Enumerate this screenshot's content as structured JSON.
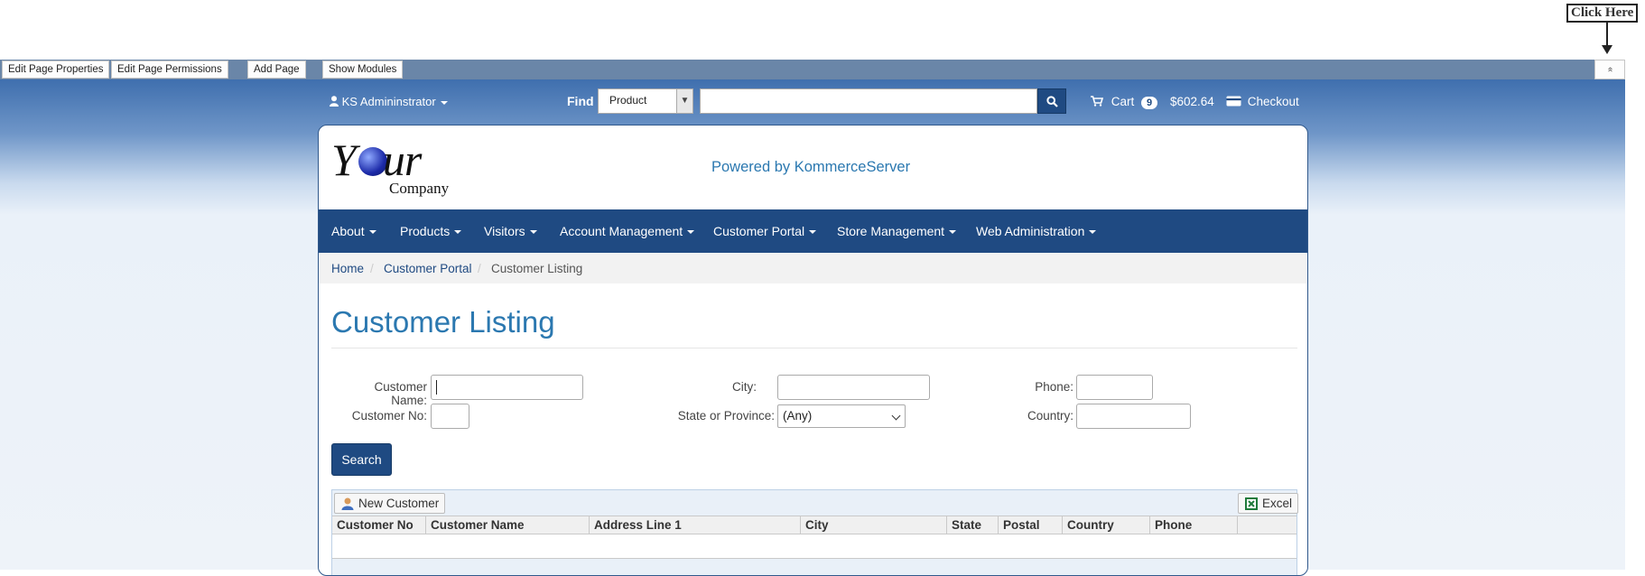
{
  "annotation": {
    "label": "Click Here"
  },
  "admin_bar": {
    "buttons": [
      "Edit Page Properties",
      "Edit Page Permissions",
      "Add Page",
      "Show Modules"
    ],
    "collapse_label": "«"
  },
  "header": {
    "user_name": "KS Admininstrator",
    "find_label": "Find",
    "find_scope": "Product",
    "find_value": "",
    "cart_label": "Cart",
    "cart_count": "9",
    "cart_total": "$602.64",
    "checkout_label": "Checkout"
  },
  "brand": {
    "logo_your_1": "Y",
    "logo_your_2": "ur",
    "logo_company": "Company",
    "powered_by": "Powered by KommerceServer"
  },
  "nav": {
    "items": [
      "About",
      "Products",
      "Visitors",
      "Account Management",
      "Customer Portal",
      "Store Management",
      "Web Administration"
    ]
  },
  "breadcrumb": {
    "items": [
      "Home",
      "Customer Portal",
      "Customer Listing"
    ],
    "separator": "/"
  },
  "page": {
    "title": "Customer Listing"
  },
  "filters": {
    "customer_name_label": "Customer Name:",
    "customer_name_value": "",
    "customer_no_label": "Customer No:",
    "customer_no_value": "",
    "city_label": "City:",
    "city_value": "",
    "state_label": "State or Province:",
    "state_value": "(Any)",
    "phone_label": "Phone:",
    "phone_value": "",
    "country_label": "Country:",
    "country_value": "",
    "search_label": "Search"
  },
  "grid": {
    "new_customer_label": "New Customer",
    "excel_label": "Excel",
    "columns": [
      "Customer No",
      "Customer Name",
      "Address Line 1",
      "City",
      "State",
      "Postal",
      "Country",
      "Phone",
      ""
    ],
    "rows": []
  },
  "colors": {
    "primary": "#1f4a82",
    "link": "#2b78b0",
    "admin_bar": "#6a86a8"
  }
}
